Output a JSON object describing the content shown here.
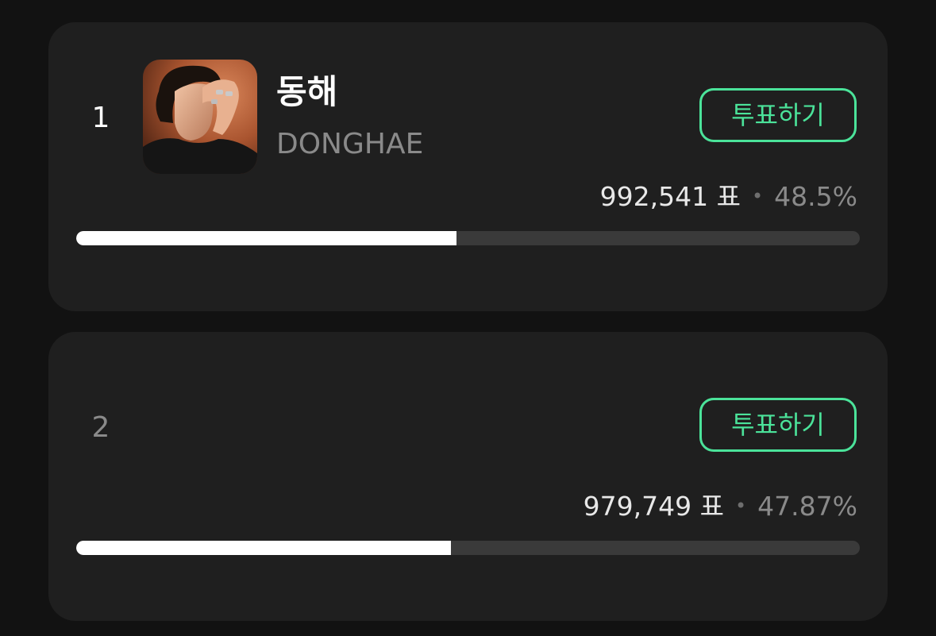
{
  "candidates": [
    {
      "rank": "1",
      "name": "동해",
      "name_en": "DONGHAE",
      "vote_label": "투표하기",
      "votes": "992,541 표",
      "separator": "•",
      "percent": "48.5%",
      "progress_fraction": 0.485,
      "has_photo": true
    },
    {
      "rank": "2",
      "name": "",
      "name_en": "",
      "vote_label": "투표하기",
      "votes": "979,749 표",
      "separator": "•",
      "percent": "47.87%",
      "progress_fraction": 0.4787,
      "has_photo": false
    }
  ],
  "colors": {
    "background": "#121212",
    "card": "#1f1f1f",
    "accent": "#4be39a",
    "bar_track": "#3a3a3a",
    "bar_fill": "#ffffff"
  }
}
